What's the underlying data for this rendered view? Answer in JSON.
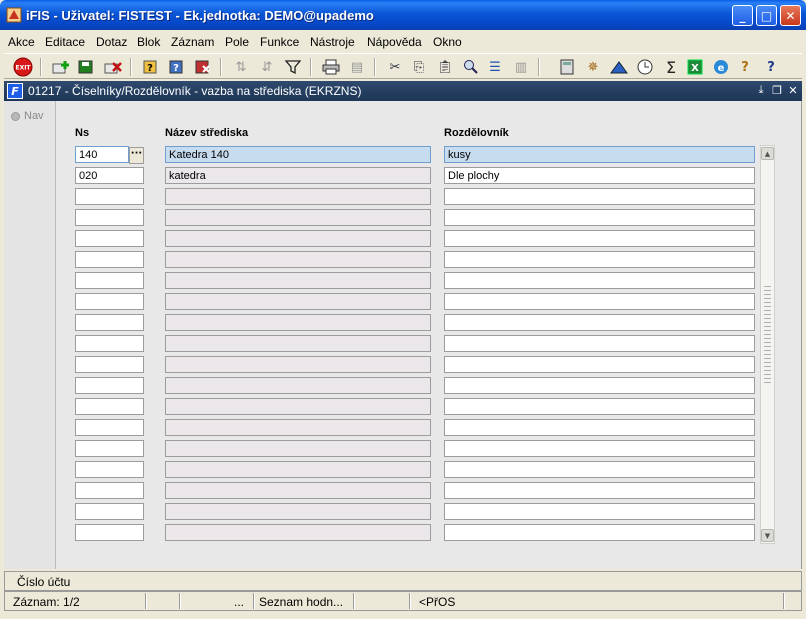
{
  "window": {
    "title": "iFIS - Uživatel: FISTEST - Ek.jednotka: DEMO@upademo"
  },
  "menu": [
    "Akce",
    "Editace",
    "Dotaz",
    "Blok",
    "Záznam",
    "Pole",
    "Funkce",
    "Nástroje",
    "Nápověda",
    "Okno"
  ],
  "toolbar": {
    "exit_label": "EXIT"
  },
  "form": {
    "title": "01217 - Číselníky/Rozdělovník - vazba na střediska (EKRZNS)",
    "nav_label": "Nav",
    "columns": {
      "ns": "Ns",
      "nazev": "Název střediska",
      "rozdelovnik": "Rozdělovník"
    },
    "rows": [
      {
        "ns": "140",
        "nazev": "Katedra 140",
        "rozdelovnik": "kusy"
      },
      {
        "ns": "020",
        "nazev": "katedra",
        "rozdelovnik": "Dle plochy"
      },
      {
        "ns": "",
        "nazev": "",
        "rozdelovnik": ""
      },
      {
        "ns": "",
        "nazev": "",
        "rozdelovnik": ""
      },
      {
        "ns": "",
        "nazev": "",
        "rozdelovnik": ""
      },
      {
        "ns": "",
        "nazev": "",
        "rozdelovnik": ""
      },
      {
        "ns": "",
        "nazev": "",
        "rozdelovnik": ""
      },
      {
        "ns": "",
        "nazev": "",
        "rozdelovnik": ""
      },
      {
        "ns": "",
        "nazev": "",
        "rozdelovnik": ""
      },
      {
        "ns": "",
        "nazev": "",
        "rozdelovnik": ""
      },
      {
        "ns": "",
        "nazev": "",
        "rozdelovnik": ""
      },
      {
        "ns": "",
        "nazev": "",
        "rozdelovnik": ""
      },
      {
        "ns": "",
        "nazev": "",
        "rozdelovnik": ""
      },
      {
        "ns": "",
        "nazev": "",
        "rozdelovnik": ""
      },
      {
        "ns": "",
        "nazev": "",
        "rozdelovnik": ""
      },
      {
        "ns": "",
        "nazev": "",
        "rozdelovnik": ""
      },
      {
        "ns": "",
        "nazev": "",
        "rozdelovnik": ""
      },
      {
        "ns": "",
        "nazev": "",
        "rozdelovnik": ""
      },
      {
        "ns": "",
        "nazev": "",
        "rozdelovnik": ""
      }
    ],
    "lov_symbol": "···"
  },
  "status": {
    "hint": "Číslo účtu",
    "record": "Záznam: 1/2",
    "dots": "...",
    "lov": "Seznam hodn...",
    "mode": "<PřOS"
  },
  "colors": {
    "titlebar": "#0a56d8",
    "active_row": "#c8dcf0",
    "readonly_cell": "#ece7ea"
  }
}
